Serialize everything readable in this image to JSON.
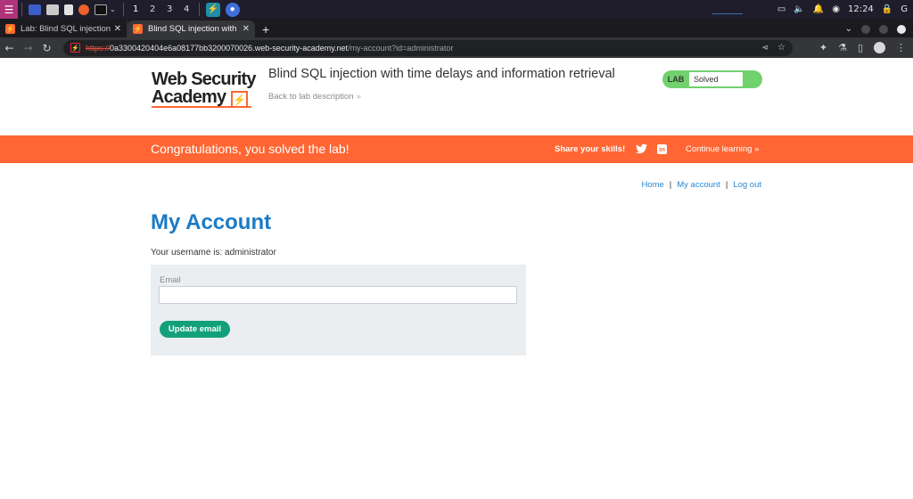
{
  "os": {
    "workspaces": [
      "1",
      "2",
      "3",
      "4"
    ],
    "clock": "12:24",
    "icons": [
      "kali-menu-icon",
      "desktop-icon",
      "file-manager-icon",
      "text-editor-icon",
      "firefox-icon",
      "terminal-icon",
      "burp-icon",
      "chromium-icon",
      "display-icon",
      "volume-icon",
      "bell-icon",
      "record-icon",
      "lock-icon"
    ]
  },
  "browser": {
    "tabs": [
      {
        "label": "Lab: Blind SQL injection w",
        "active": false
      },
      {
        "label": "Blind SQL injection with t",
        "active": true
      }
    ],
    "new_tab": "+",
    "url": {
      "scheme": "https://",
      "host": "0a3300420404e6a08177bb3200070026.web-security-academy.net",
      "path": "/my-account?id=administrator"
    }
  },
  "header": {
    "logo_line1": "Web Security",
    "logo_line2": "Academy",
    "logo_bolt": "⚡",
    "lab_title": "Blind SQL injection with time delays and information retrieval",
    "back_link": "Back to lab description",
    "badge_label": "LAB",
    "badge_state": "Solved",
    "colors": {
      "accent": "#ff6633",
      "badge": "#70d16d",
      "link": "#2b8ad2",
      "heading": "#1b7bc6",
      "button": "#12a07a"
    }
  },
  "banner": {
    "message": "Congratulations, you solved the lab!",
    "share": "Share your skills!",
    "continue": "Continue learning"
  },
  "nav": {
    "home": "Home",
    "sep": "|",
    "my_account": "My account",
    "logout": "Log out"
  },
  "main": {
    "title": "My Account",
    "username_text": "Your username is: administrator",
    "email_label": "Email",
    "email_value": "",
    "update_button": "Update email"
  }
}
